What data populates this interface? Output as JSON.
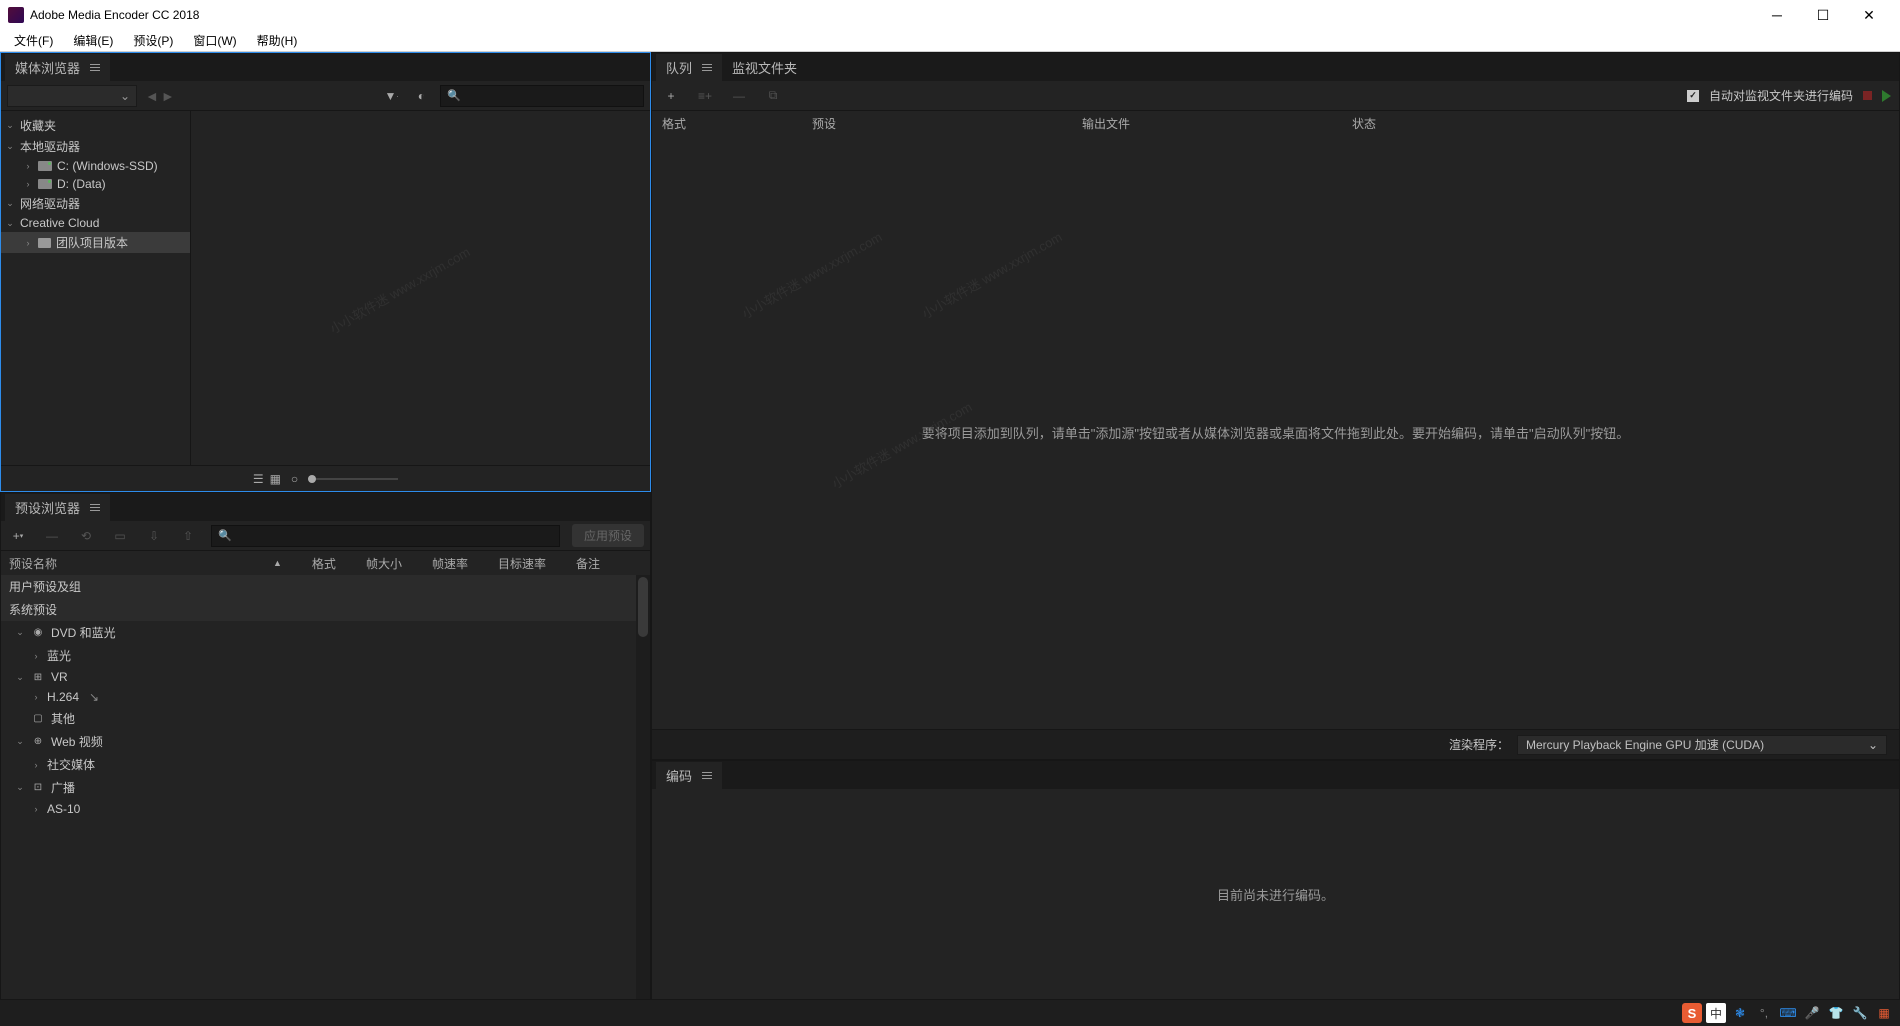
{
  "app": {
    "title": "Adobe Media Encoder CC 2018"
  },
  "menubar": [
    "文件(F)",
    "编辑(E)",
    "预设(P)",
    "窗口(W)",
    "帮助(H)"
  ],
  "media_browser": {
    "title": "媒体浏览器",
    "tree": {
      "favorites": "收藏夹",
      "local_drives": "本地驱动器",
      "drive_c": "C: (Windows-SSD)",
      "drive_d": "D: (Data)",
      "network_drives": "网络驱动器",
      "creative_cloud": "Creative Cloud",
      "team_project": "团队项目版本"
    }
  },
  "preset_browser": {
    "title": "预设浏览器",
    "apply_btn": "应用预设",
    "headers": {
      "name": "预设名称",
      "format": "格式",
      "frame_size": "帧大小",
      "frame_rate": "帧速率",
      "target_rate": "目标速率",
      "comment": "备注"
    },
    "groups": {
      "user": "用户预设及组",
      "system": "系统预设",
      "dvd_bluray": "DVD 和蓝光",
      "bluray": "蓝光",
      "vr": "VR",
      "h264": "H.264",
      "other": "其他",
      "web_video": "Web 视频",
      "social": "社交媒体",
      "broadcast": "广播",
      "as10": "AS-10"
    }
  },
  "queue": {
    "tab_queue": "队列",
    "tab_watch": "监视文件夹",
    "auto_encode": "自动对监视文件夹进行编码",
    "headers": {
      "format": "格式",
      "preset": "预设",
      "output": "输出文件",
      "status": "状态"
    },
    "empty_msg": "要将项目添加到队列，请单击\"添加源\"按钮或者从媒体浏览器或桌面将文件拖到此处。要开始编码，请单击\"启动队列\"按钮。",
    "renderer_label": "渲染程序：",
    "renderer_value": "Mercury Playback Engine GPU 加速 (CUDA)"
  },
  "encode": {
    "title": "编码",
    "empty_msg": "目前尚未进行编码。"
  },
  "watermark": "小小软件迷 www.xxrjm.com",
  "taskbar": {
    "ime_lang": "中"
  }
}
